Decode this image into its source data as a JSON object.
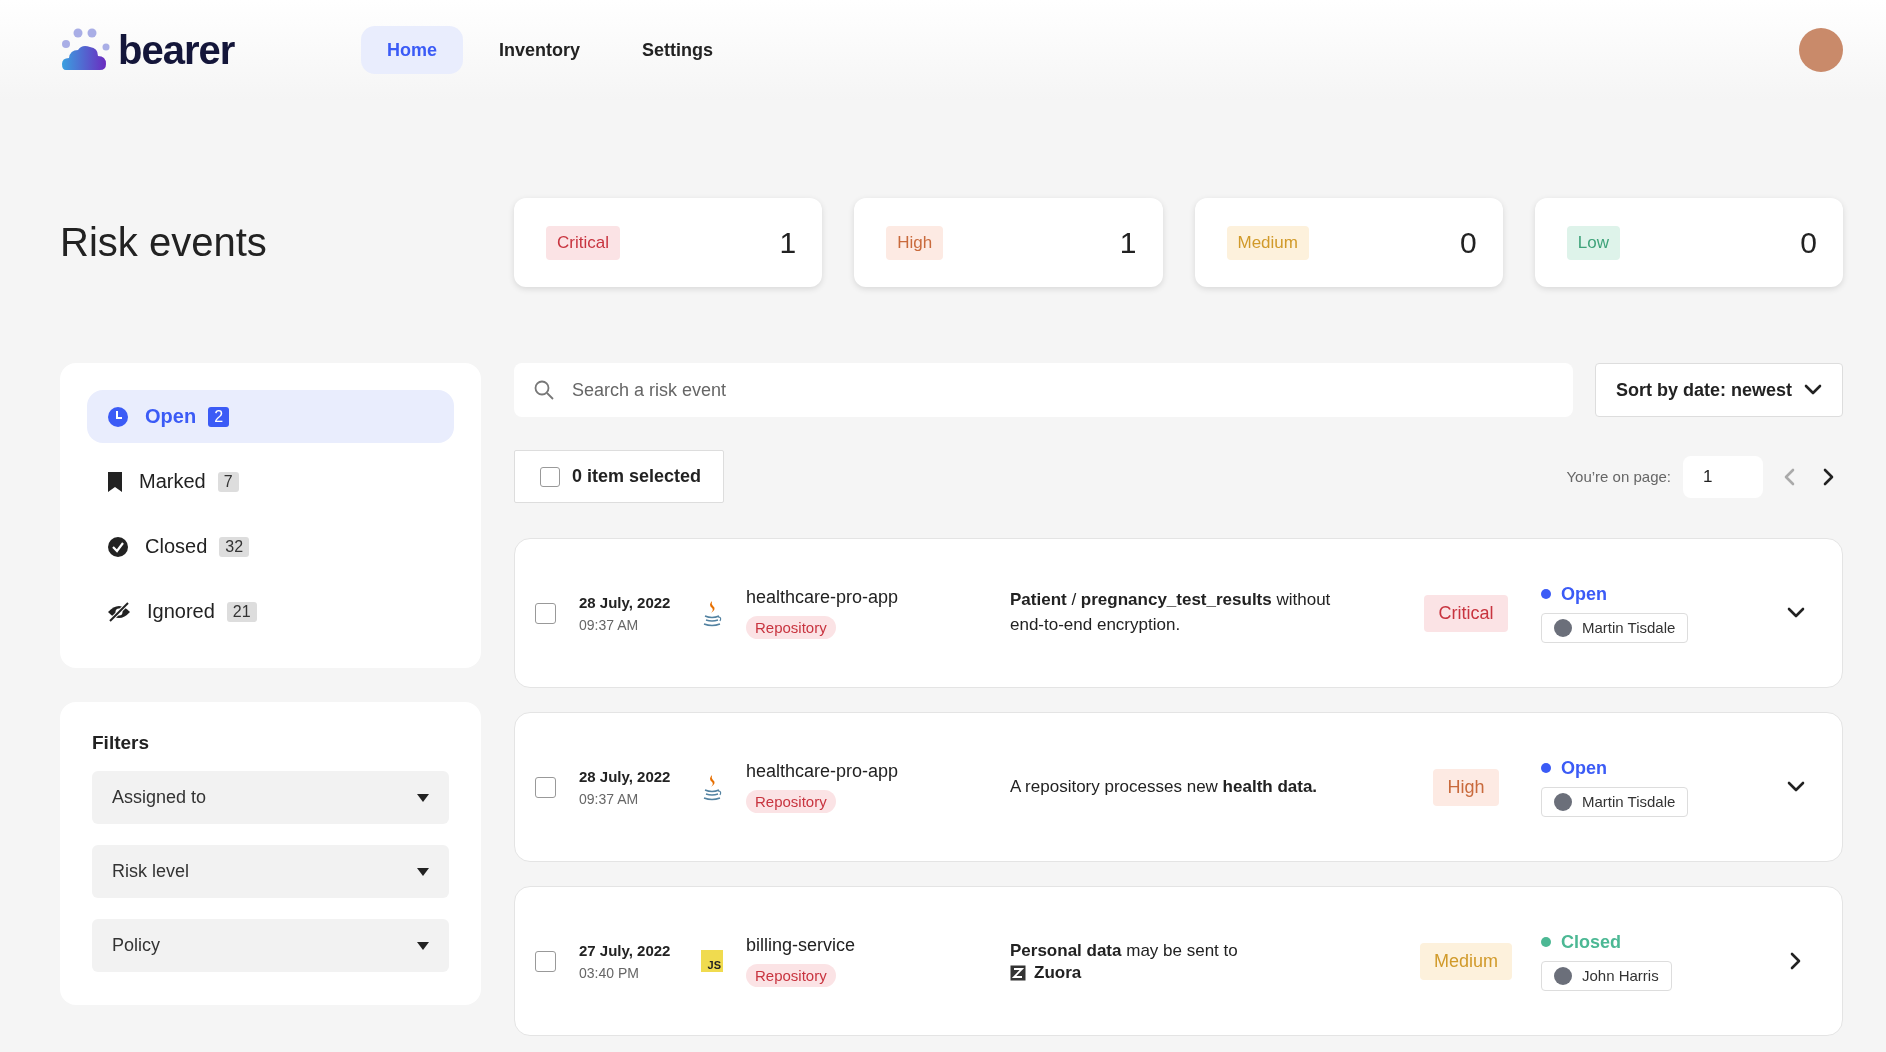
{
  "header": {
    "logo": "bearer",
    "nav": [
      {
        "label": "Home",
        "selected": true
      },
      {
        "label": "Inventory",
        "selected": false
      },
      {
        "label": "Settings",
        "selected": false
      }
    ]
  },
  "title": "Risk events",
  "severity_counts": [
    {
      "label": "Critical",
      "kind": "critical",
      "count": "1"
    },
    {
      "label": "High",
      "kind": "high",
      "count": "1"
    },
    {
      "label": "Medium",
      "kind": "medium",
      "count": "0"
    },
    {
      "label": "Low",
      "kind": "low",
      "count": "0"
    }
  ],
  "sidebar": {
    "items": [
      {
        "label": "Open",
        "count": "2",
        "kind": "open",
        "selected": true
      },
      {
        "label": "Marked",
        "count": "7",
        "kind": "marked",
        "selected": false
      },
      {
        "label": "Closed",
        "count": "32",
        "kind": "closed",
        "selected": false
      },
      {
        "label": "Ignored",
        "count": "21",
        "kind": "ignored",
        "selected": false
      }
    ]
  },
  "filters": {
    "title": "Filters",
    "dropdowns": [
      "Assigned to",
      "Risk level",
      "Policy"
    ]
  },
  "search": {
    "placeholder": "Search a risk event"
  },
  "sort": {
    "label": "Sort by date: newest"
  },
  "selection": {
    "label": "0 item selected",
    "checked": false
  },
  "pagination": {
    "label": "You’re on page:",
    "page": "1",
    "prev": {
      "disabled": true
    },
    "next": {
      "disabled": false
    }
  },
  "events": [
    {
      "checked": false,
      "date": "28 July, 2022",
      "time": "09:37 AM",
      "language": {
        "kind": "java"
      },
      "repo": "healthcare-pro-app",
      "repo_type": "Repository",
      "description": "**Patient** / **pregnancy_test_results** without end-to-end encryption.",
      "severity": {
        "label": "Critical",
        "kind": "critical"
      },
      "status": {
        "label": "Open",
        "color": "#3b5bf6"
      },
      "assignee": {
        "name": "Martin Tisdale"
      },
      "kind": "expandable"
    },
    {
      "checked": false,
      "date": "28 July, 2022",
      "time": "09:37 AM",
      "language": {
        "kind": "java"
      },
      "repo": "healthcare-pro-app",
      "repo_type": "Repository",
      "description": "A repository processes new **health data.**",
      "severity": {
        "label": "High",
        "kind": "high"
      },
      "status": {
        "label": "Open",
        "color": "#3b5bf6"
      },
      "assignee": {
        "name": "Martin Tisdale"
      },
      "kind": "expandable"
    },
    {
      "checked": false,
      "date": "27 July, 2022",
      "time": "03:40 PM",
      "language": {
        "kind": "js",
        "label": "JS"
      },
      "repo": "billing-service",
      "repo_type": "Repository",
      "description": "**Personal data** may be sent to",
      "destination": {
        "name": "Zuora"
      },
      "severity": {
        "label": "Medium",
        "kind": "medium"
      },
      "status": {
        "label": "Closed",
        "color": "#4cb894"
      },
      "assignee": {
        "name": "John Harris"
      },
      "kind": "link"
    }
  ]
}
